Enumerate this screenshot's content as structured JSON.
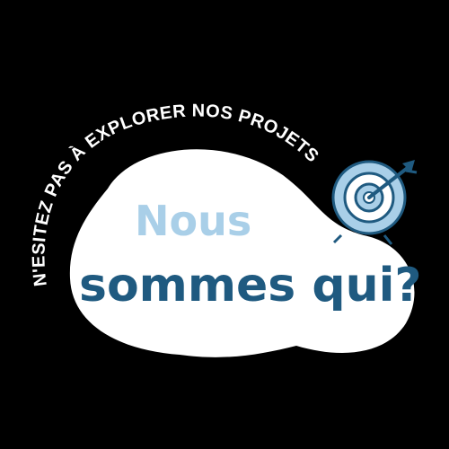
{
  "banner": {
    "arc_text": "N'ESITEZ PAS À EXPLORER NOS PROJETS"
  },
  "headline": {
    "line1": "Nous",
    "line2": "sommes qui?"
  },
  "icon": {
    "name": "target-arrow-icon"
  },
  "colors": {
    "background": "#000000",
    "blob": "#ffffff",
    "line1": "#a9cfe8",
    "line2": "#1f5a80",
    "target_outer": "#a9cfe8",
    "target_ring": "#1f5a80",
    "arrow": "#1f5a80"
  }
}
